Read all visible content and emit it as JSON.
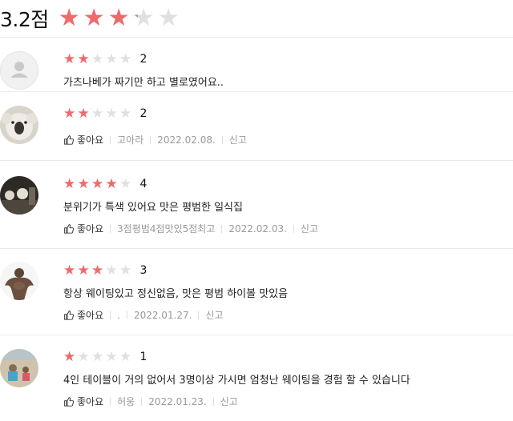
{
  "summary": {
    "score_text": "3.2점",
    "rating": 3.2,
    "max": 5
  },
  "colors": {
    "star_active": "#ee6b6b",
    "star_inactive": "#e0e0e0"
  },
  "reviews": [
    {
      "rating": 2,
      "rating_text": "2",
      "text": "가츠나베가 짜기만 하고 별로였어요..",
      "avatar_icon": "default-person-avatar"
    },
    {
      "rating": 2,
      "rating_text": "2",
      "text": "",
      "like_label": "좋아요",
      "author": "고아라",
      "date": "2022.02.08.",
      "report_label": "신고",
      "avatar_icon": "koala-avatar"
    },
    {
      "rating": 4,
      "rating_text": "4",
      "text": "분위기가 특색 있어요 맛은 평범한 일식집",
      "like_label": "좋아요",
      "author": "3점평범4점맛있5점최고",
      "date": "2022.02.03.",
      "report_label": "신고",
      "avatar_icon": "dark-scene-avatar"
    },
    {
      "rating": 3,
      "rating_text": "3",
      "text": "항상 웨이팅있고 정신없음, 맛은 평범 하이볼 맛있음",
      "like_label": "좋아요",
      "author": ".",
      "date": "2022.01.27.",
      "report_label": "신고",
      "avatar_icon": "muscle-man-avatar"
    },
    {
      "rating": 1,
      "rating_text": "1",
      "text": "4인 테이블이 거의 없어서 3명이상 가시면 엄청난 웨이팅을 경험 할 수 있습니다",
      "like_label": "좋아요",
      "author": "허웅",
      "date": "2022.01.23.",
      "report_label": "신고",
      "avatar_icon": "beach-photo-avatar"
    }
  ]
}
